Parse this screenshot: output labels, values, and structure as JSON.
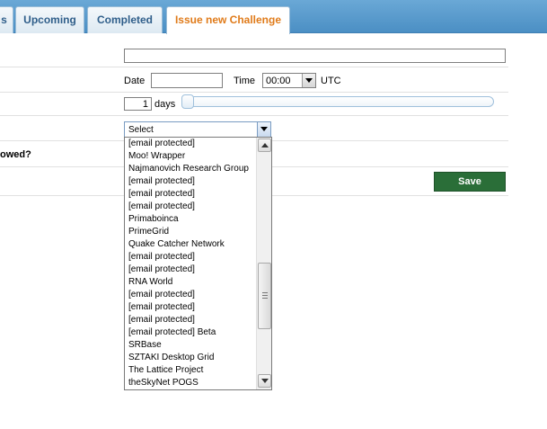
{
  "tabs": [
    {
      "label": "s",
      "active": false
    },
    {
      "label": "Upcoming",
      "active": false
    },
    {
      "label": "Completed",
      "active": false
    },
    {
      "label": "Issue new Challenge",
      "active": true
    }
  ],
  "form": {
    "name_value": "",
    "date_label": "Date",
    "date_value": "",
    "time_label": "Time",
    "time_value": "00:00",
    "utc_label": "UTC",
    "duration_value": "1",
    "days_label": "days",
    "duration_slider_fraction": 0,
    "project_select_value": "Select",
    "allowed_question": "owed?",
    "save_label": "Save"
  },
  "dropdown": {
    "items": [
      "[email protected]",
      "Moo! Wrapper",
      "Najmanovich Research Group",
      "[email protected]",
      "[email protected]",
      "[email protected]",
      "Primaboinca",
      "PrimeGrid",
      "Quake Catcher Network",
      "[email protected]",
      "[email protected]",
      "RNA World",
      "[email protected]",
      "[email protected]",
      "[email protected]",
      "[email protected] Beta",
      "SRBase",
      "SZTAKI Desktop Grid",
      "The Lattice Project",
      "theSkyNet POGS"
    ]
  },
  "colors": {
    "tab_bar": "#4b8fc4",
    "active_tab_text": "#e07b1a",
    "tab_text": "#2f5e8a",
    "save_button": "#2a6e38"
  }
}
